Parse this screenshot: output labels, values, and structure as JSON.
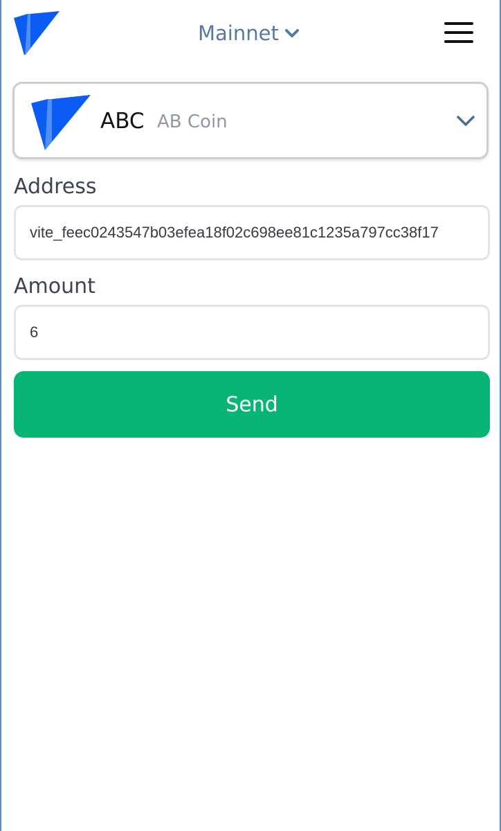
{
  "header": {
    "network_label": "Mainnet",
    "icons": {
      "logo": "vite-logo-icon",
      "network_dropdown": "chevron-down-icon",
      "menu": "hamburger-menu-icon"
    }
  },
  "token": {
    "symbol": "ABC",
    "name": "AB Coin",
    "icons": {
      "logo": "token-logo-icon",
      "dropdown": "chevron-down-icon"
    }
  },
  "form": {
    "address_label": "Address",
    "address_value": "vite_feec0243547b03efea18f02c698ee81c1235a797cc38f17",
    "amount_label": "Amount",
    "amount_value": "6",
    "send_label": "Send"
  },
  "colors": {
    "brand_blue": "#0b5cf2",
    "network_text": "#5579a6",
    "send_button": "#08b574",
    "frame_border": "#5b8fc0"
  }
}
